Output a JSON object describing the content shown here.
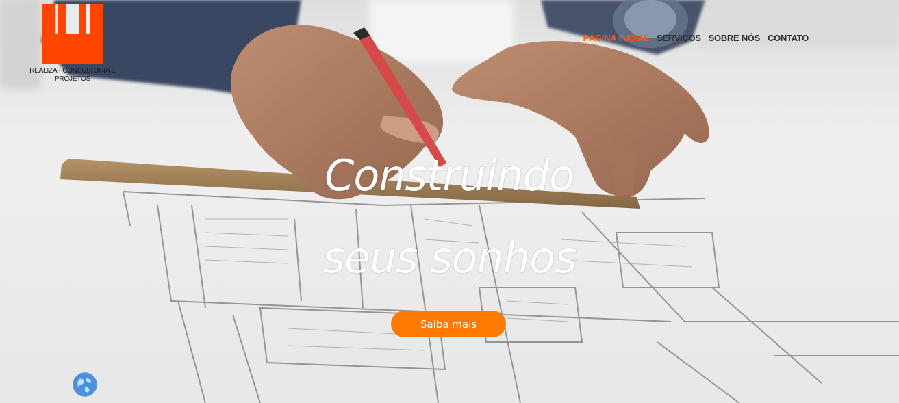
{
  "brand": {
    "name": "REALIZA - CONSULTORIA E PROJETOS",
    "logo_icon": "bar-chart-logo-icon",
    "color": "#ff4500"
  },
  "nav": {
    "items": [
      {
        "label": "PÁGINA INICIAL",
        "active": true
      },
      {
        "label": "SERVIÇOS",
        "active": false
      },
      {
        "label": "SOBRE NÓS",
        "active": false
      },
      {
        "label": "CONTATO",
        "active": false
      }
    ],
    "active_color": "#ff5a0a",
    "text_color": "#2b2b2b"
  },
  "hero": {
    "line1": "Construindo",
    "line2": "seus sonhos",
    "cta_label": "Saiba mais",
    "cta_color": "#ff7a00"
  },
  "widgets": {
    "globe_icon": "globe-icon"
  }
}
